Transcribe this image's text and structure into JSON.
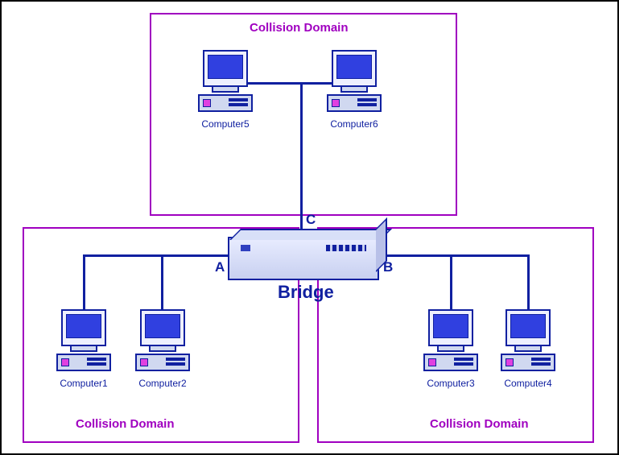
{
  "diagram": {
    "topDomain": {
      "title": "Collision Domain"
    },
    "leftDomain": {
      "title": "Collision Domain"
    },
    "rightDomain": {
      "title": "Collision Domain"
    },
    "bridge": {
      "label": "Bridge",
      "portA": "A",
      "portB": "B",
      "portC": "C"
    },
    "computers": {
      "c1": "Computer1",
      "c2": "Computer2",
      "c3": "Computer3",
      "c4": "Computer4",
      "c5": "Computer5",
      "c6": "Computer6"
    }
  }
}
